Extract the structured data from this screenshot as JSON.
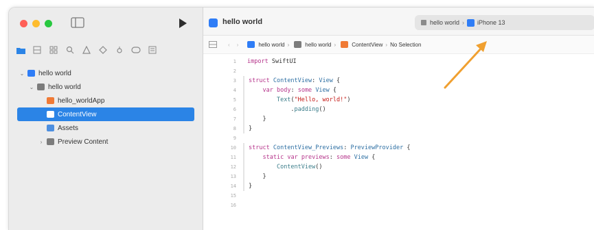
{
  "window": {
    "traffic_lights": [
      "#ff5f57",
      "#febc2e",
      "#28c840"
    ],
    "accent": "#2b84e6"
  },
  "toolbar": {
    "project_title": "hello world",
    "scheme": {
      "project": "hello world",
      "device": "iPhone 13"
    }
  },
  "navigator_icons": [
    "folder-icon",
    "source-control-icon",
    "symbol-icon",
    "find-icon",
    "issue-icon",
    "test-icon",
    "debug-icon",
    "breakpoint-icon",
    "report-icon"
  ],
  "sidebar": {
    "tree": [
      {
        "label": "hello world",
        "level": 0,
        "expanded": true,
        "icon": "project-icon"
      },
      {
        "label": "hello world",
        "level": 1,
        "expanded": true,
        "icon": "folder-icon"
      },
      {
        "label": "hello_worldApp",
        "level": 2,
        "icon": "swift-file-icon"
      },
      {
        "label": "ContentView",
        "level": 2,
        "icon": "swift-file-icon",
        "selected": true
      },
      {
        "label": "Assets",
        "level": 2,
        "icon": "assets-icon"
      },
      {
        "label": "Preview Content",
        "level": 2,
        "expanded": false,
        "icon": "folder-icon"
      }
    ]
  },
  "jump_bar": {
    "crumbs": [
      "hello world",
      "hello world",
      "ContentView",
      "No Selection"
    ]
  },
  "code": {
    "lines": [
      {
        "n": "1",
        "parts": [
          [
            "kw",
            "import"
          ],
          [
            "txt",
            " SwiftUI"
          ]
        ]
      },
      {
        "n": "2",
        "parts": []
      },
      {
        "n": "3",
        "parts": [
          [
            "kw",
            "struct"
          ],
          [
            "txt",
            " "
          ],
          [
            "ty",
            "ContentView"
          ],
          [
            "txt",
            ": "
          ],
          [
            "ty",
            "View"
          ],
          [
            "txt",
            " {"
          ]
        ]
      },
      {
        "n": "4",
        "parts": [
          [
            "txt",
            "    "
          ],
          [
            "kw",
            "var"
          ],
          [
            "txt",
            " "
          ],
          [
            "kw",
            "body"
          ],
          [
            "txt",
            ": "
          ],
          [
            "kw",
            "some"
          ],
          [
            "txt",
            " "
          ],
          [
            "ty",
            "View"
          ],
          [
            "txt",
            " {"
          ]
        ]
      },
      {
        "n": "5",
        "parts": [
          [
            "txt",
            "        "
          ],
          [
            "fn",
            "Text"
          ],
          [
            "txt",
            "("
          ],
          [
            "st",
            "\"Hello, world!\""
          ],
          [
            "txt",
            ")"
          ]
        ]
      },
      {
        "n": "6",
        "parts": [
          [
            "txt",
            "            ."
          ],
          [
            "fn",
            "padding"
          ],
          [
            "txt",
            "()"
          ]
        ]
      },
      {
        "n": "7",
        "parts": [
          [
            "txt",
            "    }"
          ]
        ]
      },
      {
        "n": "8",
        "parts": [
          [
            "txt",
            "}"
          ]
        ]
      },
      {
        "n": "9",
        "parts": []
      },
      {
        "n": "10",
        "parts": [
          [
            "kw",
            "struct"
          ],
          [
            "txt",
            " "
          ],
          [
            "ty",
            "ContentView_Previews"
          ],
          [
            "txt",
            ": "
          ],
          [
            "ty",
            "PreviewProvider"
          ],
          [
            "txt",
            " {"
          ]
        ]
      },
      {
        "n": "11",
        "parts": [
          [
            "txt",
            "    "
          ],
          [
            "kw",
            "static"
          ],
          [
            "txt",
            " "
          ],
          [
            "kw",
            "var"
          ],
          [
            "txt",
            " "
          ],
          [
            "kw",
            "previews"
          ],
          [
            "txt",
            ": "
          ],
          [
            "kw",
            "some"
          ],
          [
            "txt",
            " "
          ],
          [
            "ty",
            "View"
          ],
          [
            "txt",
            " {"
          ]
        ]
      },
      {
        "n": "12",
        "parts": [
          [
            "txt",
            "        "
          ],
          [
            "fn",
            "ContentView"
          ],
          [
            "txt",
            "()"
          ]
        ]
      },
      {
        "n": "13",
        "parts": [
          [
            "txt",
            "    }"
          ]
        ]
      },
      {
        "n": "14",
        "parts": [
          [
            "txt",
            "}"
          ]
        ]
      },
      {
        "n": "15",
        "parts": []
      },
      {
        "n": "16",
        "parts": []
      }
    ]
  },
  "annotation": {
    "color": "#f0a030"
  }
}
